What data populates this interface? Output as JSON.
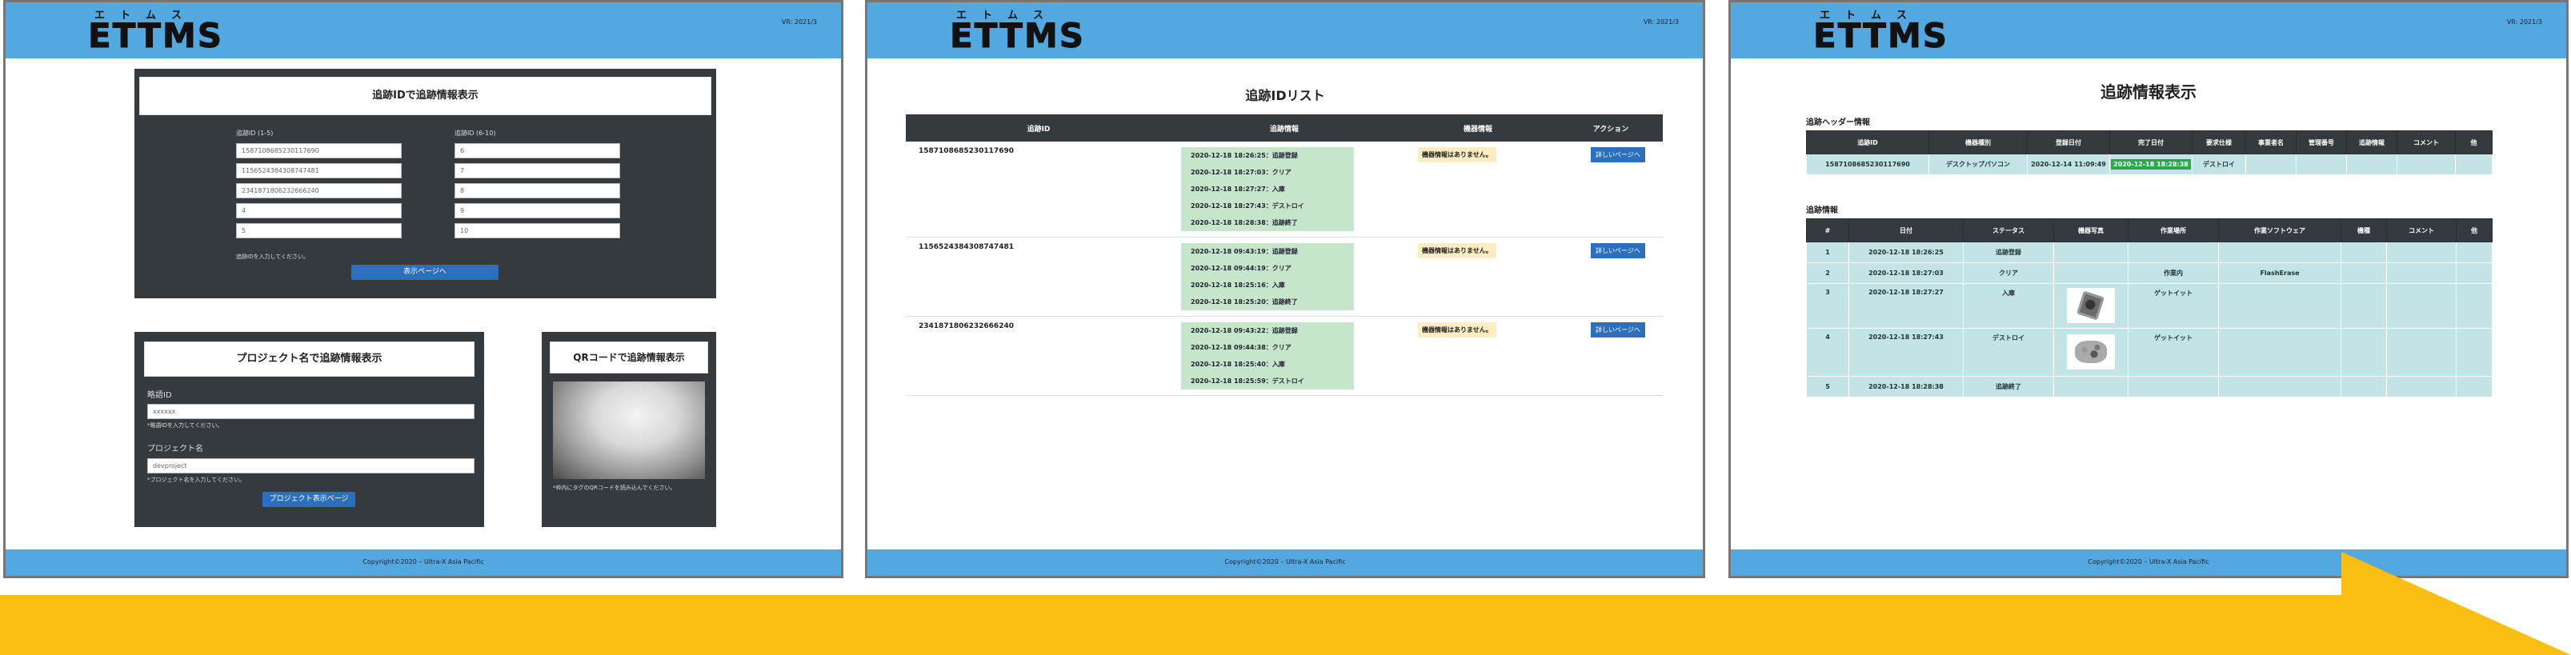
{
  "common": {
    "logo_kana": "エトムス",
    "logo_word": "ETTMS",
    "version": "VR: 2021/3",
    "footer": "Copyright©2020 – Ultra-X Asia Pacific"
  },
  "screen1": {
    "id_section": {
      "title": "追跡IDで追跡情報表示",
      "col1_label": "追跡ID (1-5)",
      "col2_label": "追跡ID (6-10)",
      "col1_values": [
        "1587108685230117690",
        "1156524384308747481",
        "2341871806232666240",
        "4",
        "5"
      ],
      "col2_values": [
        "6",
        "7",
        "8",
        "9",
        "10"
      ],
      "hint": "追跡IDを入力してください。",
      "button": "表示ページへ"
    },
    "project_section": {
      "title": "プロジェクト名で追跡情報表示",
      "company_label": "略語ID",
      "company_value": "xxxxxx",
      "company_hint": "*略語IDを入力してください。",
      "project_label": "プロジェクト名",
      "project_value": "devproject",
      "project_hint": "*プロジェクト名を入力してください。",
      "button": "プロジェクト表示ページ"
    },
    "qr_section": {
      "title": "QRコードで追跡情報表示",
      "hint": "*枠内にタグのQRコードを読み込んでください。"
    }
  },
  "screen2": {
    "title": "追跡IDリスト",
    "headers": [
      "追跡ID",
      "追跡情報",
      "機器情報",
      "アクション"
    ],
    "no_device": "機器情報はありません。",
    "detail_button": "詳しいページへ",
    "rows": [
      {
        "id": "1587108685230117690",
        "history": [
          "2020-12-18 18:26:25：追跡登録",
          "2020-12-18 18:27:03：クリア",
          "2020-12-18 18:27:27：入庫",
          "2020-12-18 18:27:43：デストロイ",
          "2020-12-18 18:28:38：追跡終了"
        ]
      },
      {
        "id": "1156524384308747481",
        "history": [
          "2020-12-18 09:43:19：追跡登録",
          "2020-12-18 09:44:19：クリア",
          "2020-12-18 18:25:16：入庫",
          "2020-12-18 18:25:20：追跡終了"
        ]
      },
      {
        "id": "2341871806232666240",
        "history": [
          "2020-12-18 09:43:22：追跡登録",
          "2020-12-18 09:44:38：クリア",
          "2020-12-18 18:25:40：入庫",
          "2020-12-18 18:25:59：デストロイ"
        ]
      }
    ]
  },
  "screen3": {
    "title": "追跡情報表示",
    "header_section": "追跡ヘッダー情報",
    "header_cols": [
      "追跡ID",
      "機器種別",
      "登録日付",
      "完了日付",
      "要求仕様",
      "事業者名",
      "管理番号",
      "追跡情報",
      "コメント",
      "他"
    ],
    "header_row": [
      "1587108685230117690",
      "デスクトップパソコン",
      "2020-12-14 11:09:49",
      "2020-12-18 18:28:38",
      "デストロイ",
      "",
      "",
      "",
      "",
      ""
    ],
    "detail_section": "追跡情報",
    "detail_cols": [
      "#",
      "日付",
      "ステータス",
      "機器写真",
      "作業場所",
      "作業ソフトウェア",
      "機種",
      "コメント",
      "他"
    ],
    "detail_rows": [
      [
        "1",
        "2020-12-18 18:26:25",
        "追跡登録",
        "",
        "",
        "",
        "",
        "",
        ""
      ],
      [
        "2",
        "2020-12-18 18:27:03",
        "クリア",
        "",
        "作業内",
        "FlashErase",
        "",
        "",
        ""
      ],
      [
        "3",
        "2020-12-18 18:27:27",
        "入庫",
        "hdd-photo",
        "ゲットイット",
        "",
        "",
        "",
        ""
      ],
      [
        "4",
        "2020-12-18 18:27:43",
        "デストロイ",
        "scrap-photo",
        "ゲットイット",
        "",
        "",
        "",
        ""
      ],
      [
        "5",
        "2020-12-18 18:28:38",
        "追跡終了",
        "",
        "",
        "",
        "",
        "",
        ""
      ]
    ]
  },
  "colors": {
    "header_blue": "#53a8df",
    "dark_panel": "#353a3f",
    "arrow": "#fbbf13",
    "history_green": "#c6e6cc",
    "table_teal": "#c2e4e6"
  }
}
